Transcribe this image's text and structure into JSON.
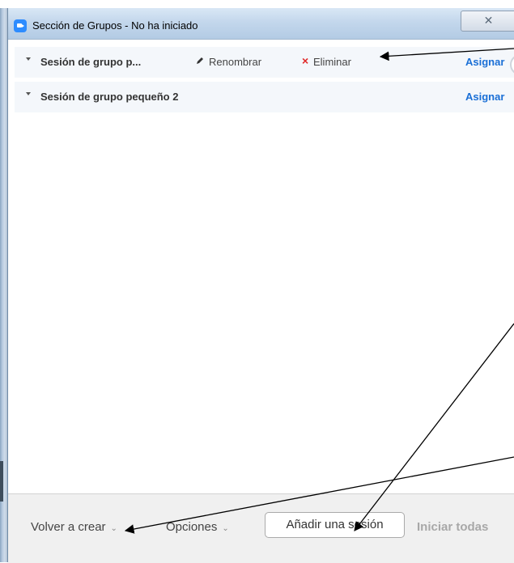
{
  "window": {
    "title": "Sección de Grupos - No ha iniciado",
    "close_glyph": "✕"
  },
  "sessions": [
    {
      "name": "Sesión de grupo p...",
      "rename_label": "Renombrar",
      "delete_label": "Eliminar",
      "assign_label": "Asignar"
    },
    {
      "name": "Sesión de grupo pequeño 2",
      "assign_label": "Asignar"
    }
  ],
  "footer": {
    "recreate_label": "Volver a crear",
    "options_label": "Opciones",
    "chevron": "⌄",
    "add_session_label": "Añadir una sesión",
    "start_all_label": "Iniciar todas"
  },
  "colors": {
    "accent": "#1a6fd6",
    "delete": "#e02828",
    "disabled": "#a8a8a8"
  }
}
